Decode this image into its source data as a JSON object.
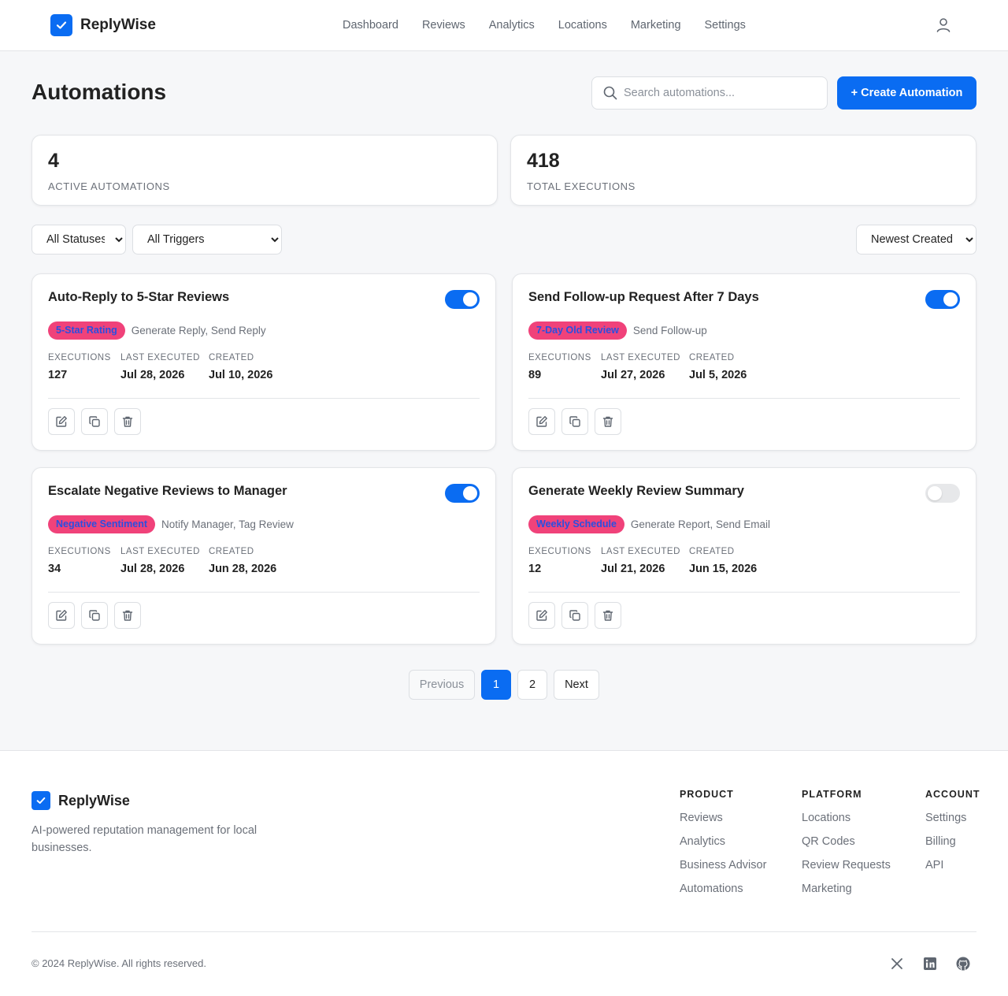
{
  "header": {
    "brand": "ReplyWise",
    "nav": [
      "Dashboard",
      "Reviews",
      "Analytics",
      "Locations",
      "Marketing",
      "Settings"
    ]
  },
  "page": {
    "title": "Automations",
    "search_placeholder": "Search automations...",
    "create_label": "+ Create Automation"
  },
  "stats": [
    {
      "value": "4",
      "label": "ACTIVE AUTOMATIONS"
    },
    {
      "value": "418",
      "label": "TOTAL EXECUTIONS"
    }
  ],
  "filters": {
    "status": "All Statuses",
    "trigger": "All Triggers",
    "sort": "Newest Created"
  },
  "metric_labels": {
    "executions": "EXECUTIONS",
    "last_executed": "LAST EXECUTED",
    "created": "CREATED"
  },
  "automations": [
    {
      "title": "Auto-Reply to 5-Star Reviews",
      "trigger": "5-Star Rating",
      "actions": "Generate Reply, Send Reply",
      "executions": "127",
      "last_executed": "Jul 28, 2026",
      "created": "Jul 10, 2026",
      "enabled": true
    },
    {
      "title": "Send Follow-up Request After 7 Days",
      "trigger": "7-Day Old Review",
      "actions": "Send Follow-up",
      "executions": "89",
      "last_executed": "Jul 27, 2026",
      "created": "Jul 5, 2026",
      "enabled": true
    },
    {
      "title": "Escalate Negative Reviews to Manager",
      "trigger": "Negative Sentiment",
      "actions": "Notify Manager, Tag Review",
      "executions": "34",
      "last_executed": "Jul 28, 2026",
      "created": "Jun 28, 2026",
      "enabled": true
    },
    {
      "title": "Generate Weekly Review Summary",
      "trigger": "Weekly Schedule",
      "actions": "Generate Report, Send Email",
      "executions": "12",
      "last_executed": "Jul 21, 2026",
      "created": "Jun 15, 2026",
      "enabled": false
    }
  ],
  "pagination": {
    "previous": "Previous",
    "pages": [
      "1",
      "2"
    ],
    "next": "Next",
    "current": "1"
  },
  "footer": {
    "brand": "ReplyWise",
    "tagline": "AI-powered reputation management for local businesses.",
    "columns": [
      {
        "title": "PRODUCT",
        "links": [
          "Reviews",
          "Analytics",
          "Business Advisor",
          "Automations"
        ]
      },
      {
        "title": "PLATFORM",
        "links": [
          "Locations",
          "QR Codes",
          "Review Requests",
          "Marketing"
        ]
      },
      {
        "title": "ACCOUNT",
        "links": [
          "Settings",
          "Billing",
          "API"
        ]
      }
    ],
    "copyright": "© 2024 ReplyWise. All rights reserved.",
    "social_icons": [
      "x-icon",
      "linkedin-icon",
      "github-icon"
    ]
  },
  "colors": {
    "accent": "#0a6cf2",
    "badge_bg": "#f0427a",
    "badge_text": "#2a4fe0"
  }
}
